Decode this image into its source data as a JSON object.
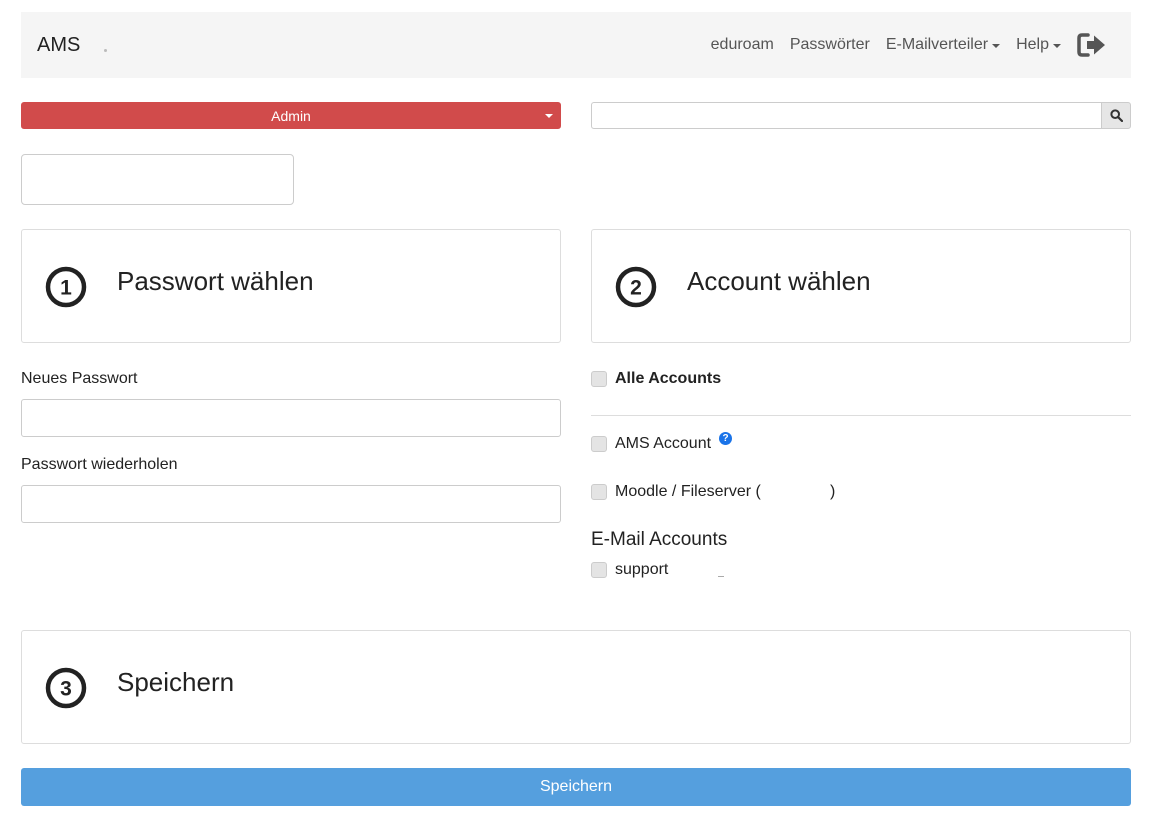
{
  "navbar": {
    "brand": "AMS",
    "links": [
      {
        "label": "eduroam"
      },
      {
        "label": "Passwörter"
      },
      {
        "label": "E-Mailverteiler"
      },
      {
        "label": "Help"
      }
    ],
    "logout_icon": "sign-out-icon"
  },
  "admin_select": {
    "label": "Admin"
  },
  "search": {
    "placeholder": "",
    "icon": "search-icon"
  },
  "step1": {
    "number": "1",
    "title": "Passwort wählen"
  },
  "step2": {
    "number": "2",
    "title": "Account wählen"
  },
  "step3": {
    "number": "3",
    "title": "Speichern"
  },
  "password_form": {
    "new_password_label": "Neues Passwort",
    "repeat_password_label": "Passwort wiederholen"
  },
  "accounts": {
    "all_accounts": "Alle Accounts",
    "ams_account": "AMS Account",
    "help_mark": "?",
    "moodle_prefix": "Moodle / Fileserver (",
    "moodle_suffix": ")",
    "email_heading": "E-Mail Accounts",
    "email_items": [
      {
        "label": "support"
      }
    ]
  },
  "save_button": {
    "label": "Speichern"
  },
  "colors": {
    "navbar_bg": "#f5f5f5",
    "admin_red": "#d14b4b",
    "save_blue": "#559fde",
    "help_blue": "#1a73e8"
  }
}
